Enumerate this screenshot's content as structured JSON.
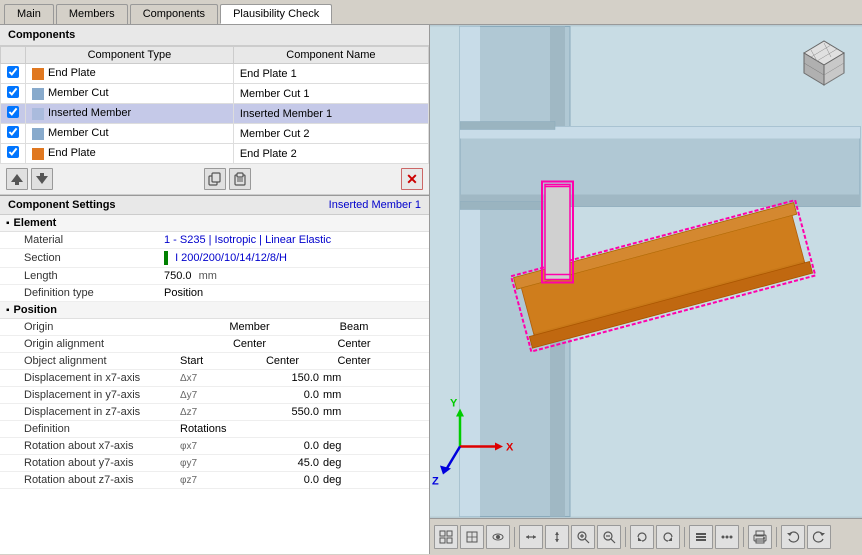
{
  "tabs": [
    {
      "id": "main",
      "label": "Main",
      "active": false
    },
    {
      "id": "members",
      "label": "Members",
      "active": false
    },
    {
      "id": "components",
      "label": "Components",
      "active": true
    },
    {
      "id": "plausibility",
      "label": "Plausibility Check",
      "active": false
    }
  ],
  "components": {
    "section_title": "Components",
    "table": {
      "headers": [
        "Component Type",
        "Component Name"
      ],
      "rows": [
        {
          "checked": true,
          "color": "#e07820",
          "type": "End Plate",
          "name": "End Plate 1",
          "selected": false
        },
        {
          "checked": true,
          "color": "#88aacc",
          "type": "Member Cut",
          "name": "Member Cut 1",
          "selected": false
        },
        {
          "checked": true,
          "color": "#aabbdd",
          "type": "Inserted Member",
          "name": "Inserted Member 1",
          "selected": true
        },
        {
          "checked": true,
          "color": "#88aacc",
          "type": "Member Cut",
          "name": "Member Cut 2",
          "selected": false
        },
        {
          "checked": true,
          "color": "#e07820",
          "type": "End Plate",
          "name": "End Plate 2",
          "selected": false
        }
      ]
    }
  },
  "toolbar_buttons": [
    {
      "id": "move-up",
      "icon": "▲",
      "tooltip": "Move up"
    },
    {
      "id": "move-down",
      "icon": "▼",
      "tooltip": "Move down"
    },
    {
      "id": "copy",
      "icon": "⧉",
      "tooltip": "Copy"
    },
    {
      "id": "paste",
      "icon": "📋",
      "tooltip": "Paste"
    },
    {
      "id": "delete",
      "icon": "✕",
      "tooltip": "Delete",
      "color": "red"
    }
  ],
  "settings": {
    "section_title": "Component Settings",
    "active_component": "Inserted Member 1",
    "groups": [
      {
        "id": "element",
        "label": "Element",
        "expanded": true,
        "properties": [
          {
            "label": "Material",
            "value": "1 - S235 | Isotropic | Linear Elastic",
            "type": "link"
          },
          {
            "label": "Section",
            "value": "I 200/200/10/14/12/8/H",
            "type": "link",
            "icon": "I"
          },
          {
            "label": "Length",
            "value": "750.0",
            "unit": "mm",
            "type": "number"
          },
          {
            "label": "Definition type",
            "value": "Position",
            "type": "text"
          }
        ]
      },
      {
        "id": "position",
        "label": "Position",
        "expanded": true,
        "sub_headers": [
          "Member",
          "Beam"
        ],
        "properties": [
          {
            "label": "Origin",
            "col1": "Member",
            "col2": "Beam",
            "type": "header-row"
          },
          {
            "label": "Origin alignment",
            "col1": "Center",
            "col2": "Center",
            "type": "dual"
          },
          {
            "label": "Object alignment",
            "sub1": "Start",
            "col1": "Center",
            "col2": "Center",
            "type": "dual-sub"
          },
          {
            "label": "Displacement in x7-axis",
            "sub": "Δx7",
            "col1": "",
            "col2": "150.0",
            "unit": "mm",
            "type": "val"
          },
          {
            "label": "Displacement in y7-axis",
            "sub": "Δy7",
            "col1": "",
            "col2": "0.0",
            "unit": "mm",
            "type": "val"
          },
          {
            "label": "Displacement in z7-axis",
            "sub": "Δz7",
            "col1": "",
            "col2": "550.0",
            "unit": "mm",
            "type": "val"
          },
          {
            "label": "Definition",
            "col1": "Rotations",
            "type": "single"
          },
          {
            "label": "Rotation about x7-axis",
            "sub": "φx7",
            "col1": "",
            "col2": "0.0",
            "unit": "deg",
            "type": "val"
          },
          {
            "label": "Rotation about y7-axis",
            "sub": "φy7",
            "col1": "",
            "col2": "45.0",
            "unit": "deg",
            "type": "val"
          },
          {
            "label": "Rotation about z7-axis",
            "sub": "φz7",
            "col1": "",
            "col2": "0.0",
            "unit": "deg",
            "type": "val"
          }
        ]
      }
    ]
  },
  "viewport_toolbar_buttons": [
    "⊞",
    "⊡",
    "👁",
    "↔",
    "↕",
    "↗",
    "↘",
    "↙",
    "⟳",
    "⟲",
    "▪",
    "▪",
    "▪",
    "▪",
    "🖨",
    "↩",
    "→"
  ]
}
